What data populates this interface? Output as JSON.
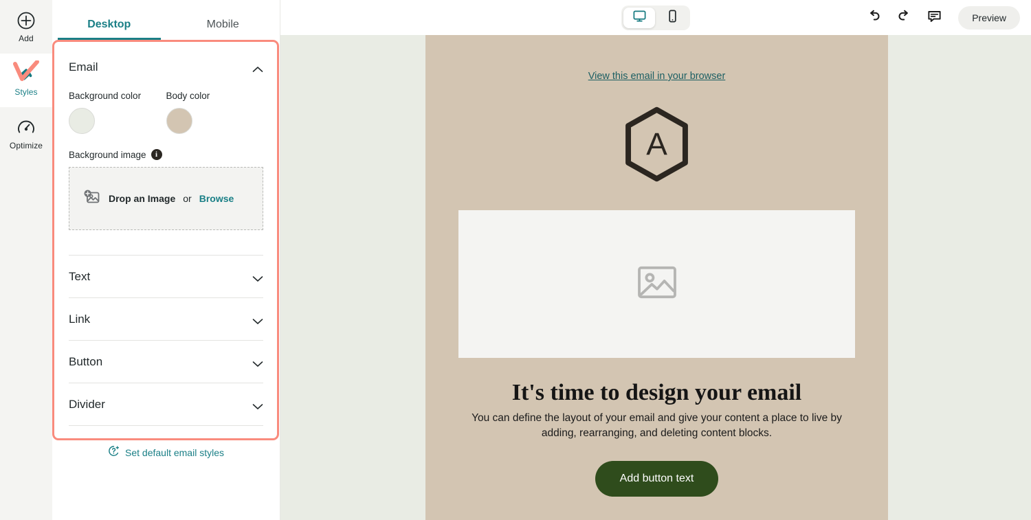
{
  "rail": {
    "items": [
      {
        "label": "Add",
        "icon": "plus-circle-icon",
        "active": false
      },
      {
        "label": "Styles",
        "icon": "paint-bucket-icon",
        "active": true
      },
      {
        "label": "Optimize",
        "icon": "gauge-icon",
        "active": false
      }
    ]
  },
  "panel": {
    "tabs": [
      {
        "label": "Desktop",
        "active": true
      },
      {
        "label": "Mobile",
        "active": false
      }
    ],
    "email_section": {
      "title": "Email",
      "chevron": "chevron-up-icon",
      "background_color_label": "Background color",
      "background_color_value": "#e9ece4",
      "body_color_label": "Body color",
      "body_color_value": "#d3c5b2",
      "background_image_label": "Background image",
      "info_icon": "info-icon",
      "dropzone": {
        "icon": "add-image-icon",
        "drop_text": "Drop an Image",
        "or_text": "or",
        "browse_text": "Browse"
      }
    },
    "accordions": [
      {
        "title": "Text",
        "chevron": "chevron-down-icon"
      },
      {
        "title": "Link",
        "chevron": "chevron-down-icon"
      },
      {
        "title": "Button",
        "chevron": "chevron-down-icon"
      },
      {
        "title": "Divider",
        "chevron": "chevron-down-icon"
      }
    ],
    "set_defaults": {
      "icon": "magic-question-icon",
      "label": "Set default email styles"
    },
    "highlight_color": "#f98b7d"
  },
  "topbar": {
    "devices": [
      {
        "name": "desktop-view",
        "icon": "monitor-icon",
        "active": true
      },
      {
        "name": "mobile-view",
        "icon": "phone-icon",
        "active": false
      }
    ],
    "undo_icon": "undo-arrow-icon",
    "redo_icon": "redo-arrow-icon",
    "comment_icon": "comment-icon",
    "preview_label": "Preview"
  },
  "email": {
    "view_in_browser": "View this email in your browser",
    "logo_letter": "A",
    "logo_shape": "hexagon-logo",
    "image_placeholder_icon": "image-placeholder-icon",
    "heading": "It's time to design your email",
    "paragraph": "You can define the layout of your email and give your content a place to live by adding, rearranging, and deleting content blocks.",
    "button_label": "Add button text",
    "button_color": "#2f4c1c",
    "canvas_background": "#e9ece4",
    "body_background": "#d3c5b2"
  }
}
